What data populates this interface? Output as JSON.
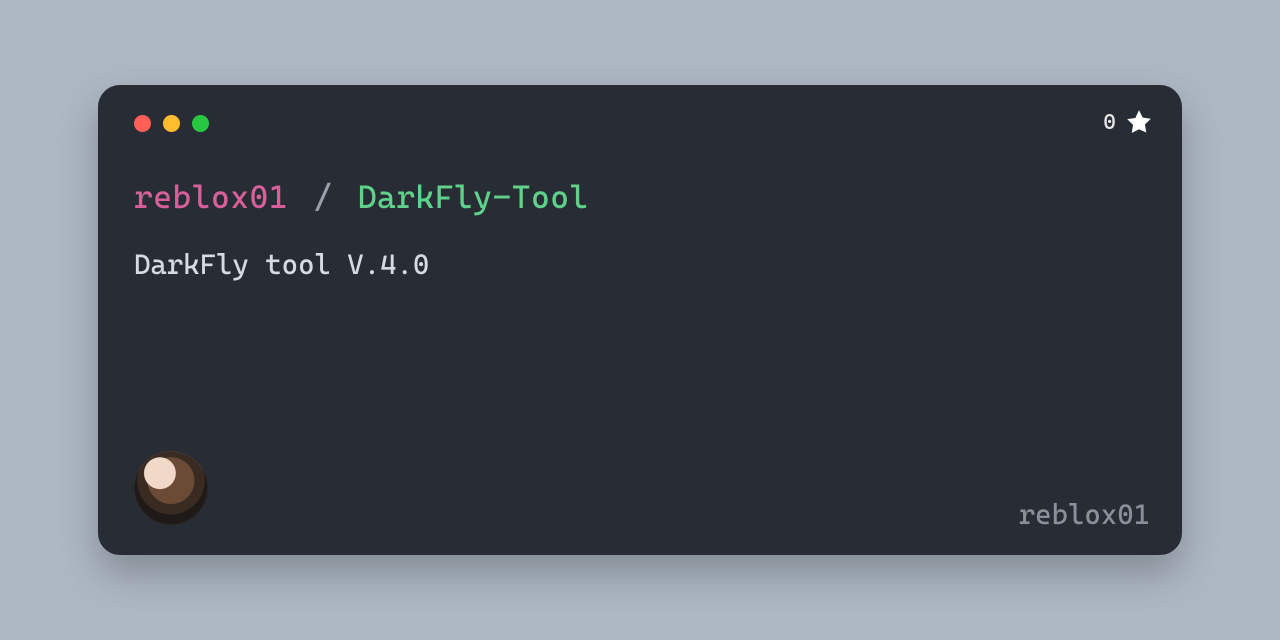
{
  "repo": {
    "owner": "reblox01",
    "separator": "/",
    "name": "DarkFly-Tool",
    "description": "DarkFly tool V.4.0"
  },
  "stars": {
    "count": "0"
  },
  "footer": {
    "username": "reblox01"
  }
}
